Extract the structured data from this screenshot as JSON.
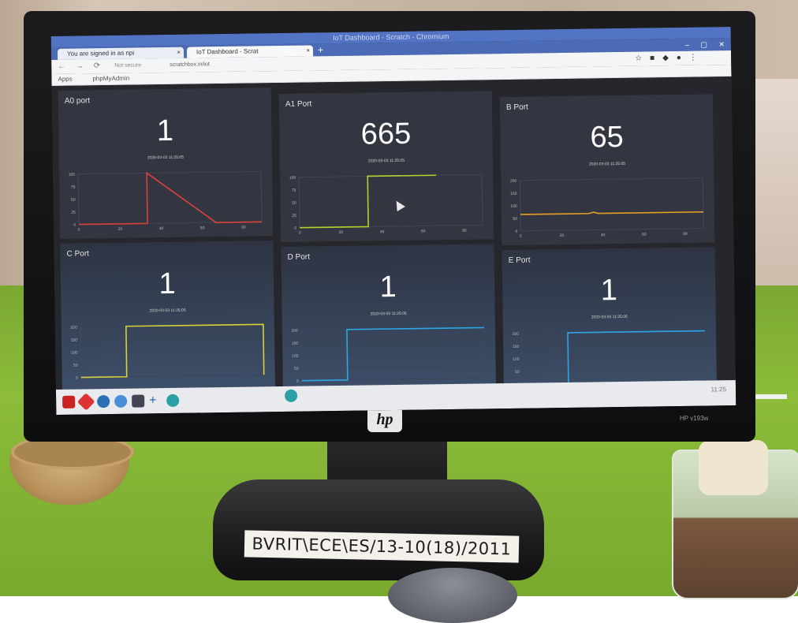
{
  "browser": {
    "window_title": "IoT Dashboard - Scratch - Chromium",
    "tabs": [
      {
        "label": "You are signed in as npi"
      },
      {
        "label": "IoT Dashboard - Scrat"
      }
    ],
    "new_tab": "+",
    "secure_label": "Not secure",
    "url": "scratchbox.in/iot",
    "bookmarks": {
      "apps": "Apps",
      "phpmyadmin": "phpMyAdmin"
    }
  },
  "dashboard": {
    "panels": [
      {
        "title": "A0 port",
        "value": "1",
        "timestamp": "2020-03-03 11:25:05"
      },
      {
        "title": "A1 Port",
        "value": "665",
        "timestamp": "2020-03-03 11:25:05"
      },
      {
        "title": "B Port",
        "value": "65",
        "timestamp": "2020-03-03 11:25:05"
      },
      {
        "title": "C Port",
        "value": "1",
        "timestamp": "2020-03-03 11:25:05"
      },
      {
        "title": "D Port",
        "value": "1",
        "timestamp": "2020-03-03 11:25:05"
      },
      {
        "title": "E Port",
        "value": "1",
        "timestamp": "2020-03-03 11:25:05"
      }
    ]
  },
  "taskbar": {
    "clock": "11:25"
  },
  "monitor": {
    "brand": "hp",
    "model": "HP v193w"
  },
  "sticker": {
    "text": "BVRIT\\ECE\\ES/13-10(18)/2011"
  },
  "chart_data": [
    {
      "type": "line",
      "title": "A0 port",
      "x": [
        0,
        20,
        30,
        30,
        60,
        80
      ],
      "y": [
        0,
        0,
        0,
        100,
        0,
        0
      ],
      "xticks": [
        "0",
        "20",
        "40",
        "60",
        "80"
      ],
      "yticks": [
        "0",
        "25",
        "50",
        "75",
        "100"
      ],
      "ylim": [
        0,
        100
      ],
      "color": "#d9433a"
    },
    {
      "type": "line",
      "title": "A1 Port",
      "x": [
        0,
        30,
        30,
        60
      ],
      "y": [
        0,
        0,
        100,
        100
      ],
      "xticks": [
        "0",
        "20",
        "40",
        "60",
        "80"
      ],
      "yticks": [
        "0",
        "25",
        "50",
        "75",
        "100"
      ],
      "ylim": [
        0,
        100
      ],
      "color": "#b5d22c"
    },
    {
      "type": "line",
      "title": "B Port",
      "x": [
        0,
        20,
        30,
        32,
        34,
        80
      ],
      "y": [
        65,
        65,
        65,
        70,
        65,
        65
      ],
      "xticks": [
        "0",
        "20",
        "40",
        "60",
        "80"
      ],
      "yticks": [
        "0",
        "50",
        "100",
        "150",
        "200"
      ],
      "ylim": [
        0,
        200
      ],
      "color": "#e8a023"
    },
    {
      "type": "line",
      "title": "C Port",
      "x": [
        0,
        20,
        20,
        80,
        80
      ],
      "y": [
        0,
        0,
        200,
        200,
        0
      ],
      "xticks": [],
      "yticks": [
        "0",
        "50",
        "100",
        "150",
        "200"
      ],
      "ylim": [
        0,
        200
      ],
      "color": "#d8d234"
    },
    {
      "type": "line",
      "title": "D Port",
      "x": [
        0,
        20,
        20,
        80
      ],
      "y": [
        0,
        0,
        200,
        200
      ],
      "xticks": [],
      "yticks": [
        "0",
        "50",
        "100",
        "150",
        "200"
      ],
      "ylim": [
        0,
        200
      ],
      "color": "#2ea6e6"
    },
    {
      "type": "line",
      "title": "E Port",
      "x": [
        0,
        20,
        20,
        80
      ],
      "y": [
        0,
        0,
        200,
        200
      ],
      "xticks": [],
      "yticks": [
        "0",
        "50",
        "100",
        "150",
        "200"
      ],
      "ylim": [
        0,
        200
      ],
      "color": "#2ea6e6"
    }
  ]
}
